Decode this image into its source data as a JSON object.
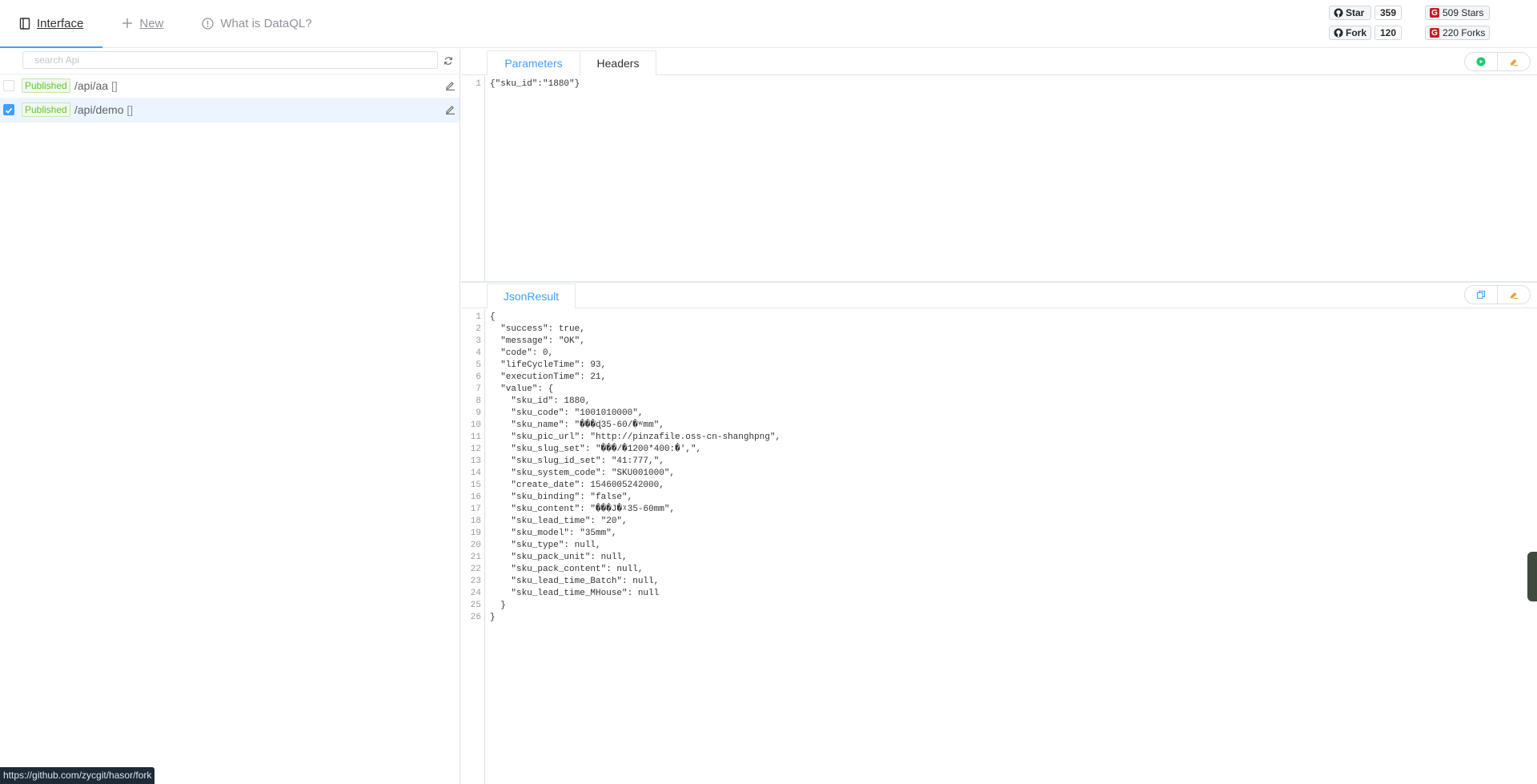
{
  "menu": {
    "interface": "Interface",
    "new": "New",
    "what_is": "What is DataQL?"
  },
  "github": {
    "star_label": "Star",
    "star_count": "359",
    "fork_label": "Fork",
    "fork_count": "120"
  },
  "gitee": {
    "stars": "509 Stars",
    "forks": "220 Forks"
  },
  "search": {
    "placeholder": "search Api"
  },
  "apis": [
    {
      "status": "Published",
      "path": "/api/aa",
      "tag": "[]",
      "checked": false
    },
    {
      "status": "Published",
      "path": "/api/demo",
      "tag": "[]",
      "checked": true
    }
  ],
  "request": {
    "tabs": [
      "Parameters",
      "Headers"
    ],
    "lines": [
      "{\"sku_id\":\"1880\"}"
    ]
  },
  "result": {
    "tab": "JsonResult",
    "lines": [
      "{",
      "  \"success\": true,",
      "  \"message\": \"OK\",",
      "  \"code\": 0,",
      "  \"lifeCycleTime\": 93,",
      "  \"executionTime\": 21,",
      "  \"value\": {",
      "    \"sku_id\": 1880,",
      "    \"sku_code\": \"1001010000\",",
      "    \"sku_name\": \"���ɖ35-60/�ʷmm\",",
      "    \"sku_pic_url\": \"http://pinzafile.oss-cn-shanghpng\",",
      "    \"sku_slug_set\": \"���/�1200*400:�',\",",
      "    \"sku_slug_id_set\": \"41:777,\",",
      "    \"sku_system_code\": \"SKU001000\",",
      "    \"create_date\": 1546005242000,",
      "    \"sku_binding\": \"false\",",
      "    \"sku_content\": \"���J�ᵡ35-60mm\",",
      "    \"sku_lead_time\": \"20\",",
      "    \"sku_model\": \"35mm\",",
      "    \"sku_type\": null,",
      "    \"sku_pack_unit\": null,",
      "    \"sku_pack_content\": null,",
      "    \"sku_lead_time_Batch\": null,",
      "    \"sku_lead_time_MHouse\": null",
      "  }",
      "}"
    ]
  },
  "status_link": "https://github.com/zycgit/hasor/fork",
  "colors": {
    "accent": "#409eff",
    "published": "#67c23a",
    "run": "#13ce66",
    "clear": "#e6a23c"
  }
}
